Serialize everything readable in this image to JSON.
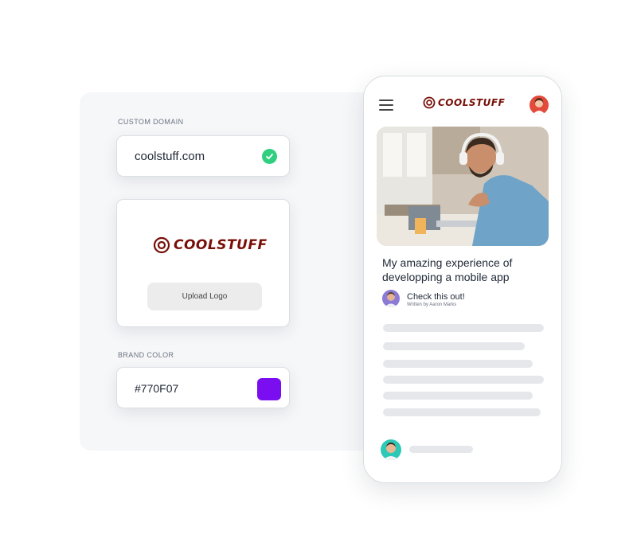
{
  "settings": {
    "custom_domain_label": "CUSTOM DOMAIN",
    "domain_value": "coolstuff.com",
    "domain_status_icon": "check-circle-icon",
    "upload_button_label": "Upload Logo",
    "brand_color_label": "BRAND COLOR",
    "brand_color_value": "#770F07",
    "swatch_color": "#7B0EF0"
  },
  "brand": {
    "logo_text": "COOLSTUFF",
    "logo_color": "#770F07"
  },
  "phone": {
    "post_title": "My amazing experience of developping a mobile app",
    "author_line": "Check this out!",
    "author_subline": "Written by Aaron Marks"
  }
}
